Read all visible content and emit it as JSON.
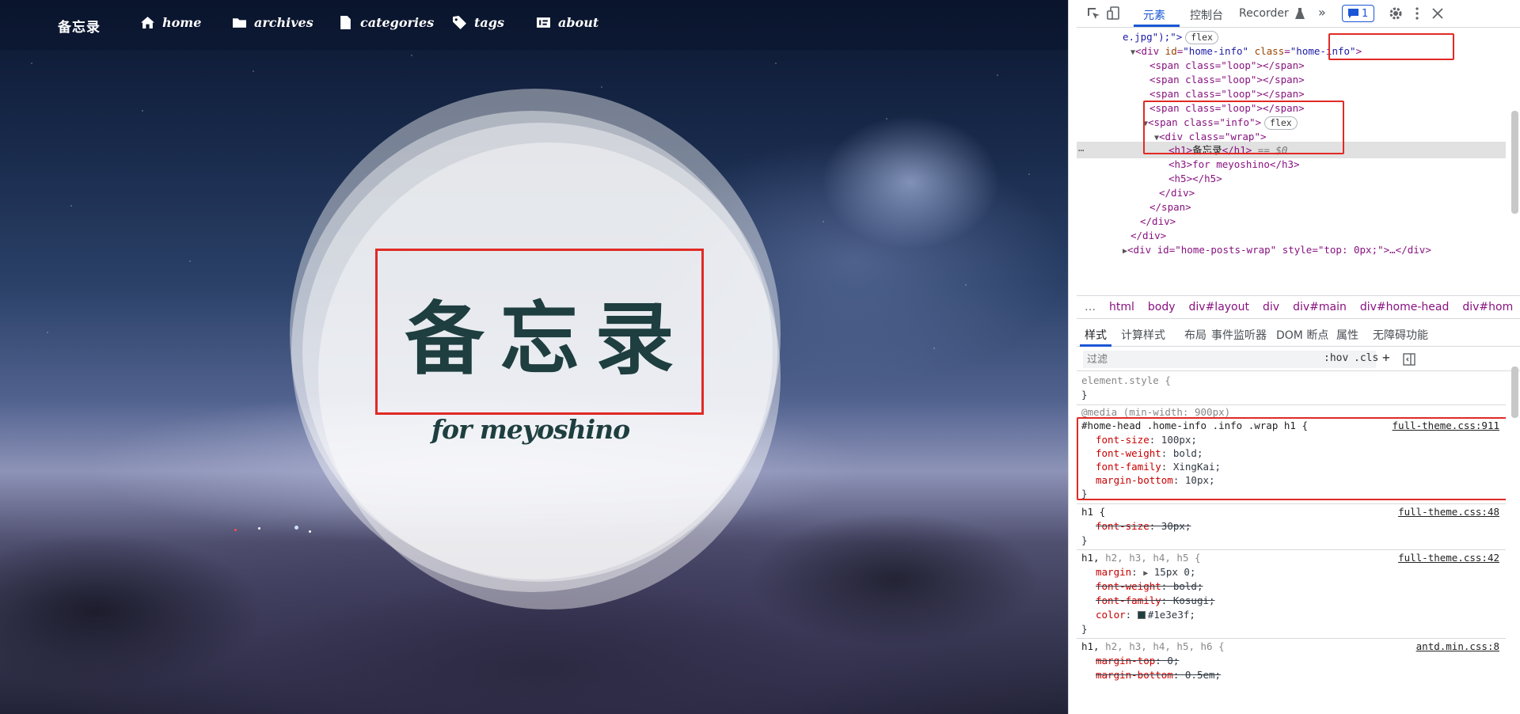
{
  "blog": {
    "brand": "备忘录",
    "nav": [
      {
        "label": "home",
        "icon": "home-icon"
      },
      {
        "label": "archives",
        "icon": "folder-icon"
      },
      {
        "label": "categories",
        "icon": "file-icon"
      },
      {
        "label": "tags",
        "icon": "tag-icon"
      },
      {
        "label": "about",
        "icon": "about-card-icon"
      }
    ],
    "title": "备忘录",
    "subtitle": "for meyoshino"
  },
  "devtools": {
    "tabs": [
      "元素",
      "控制台",
      "Recorder"
    ],
    "more_tabs_glyph": "»",
    "issues_count": "1",
    "tree": {
      "l0": {
        "pre": "e.jpg\");\">",
        "pill": "flex"
      },
      "l1": {
        "tag_open": "<div",
        "id_attr": "id",
        "id_val": "\"home-info\"",
        "class_attr": "class",
        "class_val": "\"home-info\"",
        "close": ">"
      },
      "loop_lines": [
        "<span class=\"loop\"></span>",
        "<span class=\"loop\"></span>",
        "<span class=\"loop\"></span>",
        "<span class=\"loop\"></span>"
      ],
      "info_line": {
        "text": "<span class=\"info\">",
        "pill": "flex"
      },
      "wrap_line": "<div class=\"wrap\">",
      "h1_line": {
        "open": "<h1>",
        "text": "备忘录",
        "close": "</h1>",
        "dollar": "== $0"
      },
      "h3_line": "<h3>for meyoshino</h3>",
      "h5_line": "<h5></h5>",
      "close_div_1": "</div>",
      "close_span": "</span>",
      "close_div_2": "</div>",
      "close_div_3": "</div>",
      "last_line": "<div id=\"home-posts-wrap\" style=\"top: 0px;\">…</div>"
    },
    "breadcrumbs": [
      "…",
      "html",
      "body",
      "div#layout",
      "div",
      "div#main",
      "div#home-head",
      "div#hom",
      "…"
    ],
    "subtabs": [
      "样式",
      "计算样式",
      "布局",
      "事件监听器",
      "DOM 断点",
      "属性",
      "无障碍功能"
    ],
    "filter_placeholder": "过滤",
    "filter_buttons": [
      ":hov",
      ".cls",
      "+"
    ],
    "rules": {
      "element_style": "element.style {",
      "brace_close": "}",
      "media": "@media (min-width: 900px)",
      "r1": {
        "selector": "#home-head .home-info .info .wrap h1 {",
        "source": "full-theme.css:911",
        "props": [
          {
            "name": "font-size",
            "value": "100px;"
          },
          {
            "name": "font-weight",
            "value": "bold;"
          },
          {
            "name": "font-family",
            "value": "XingKai;"
          },
          {
            "name": "margin-bottom",
            "value": "10px;"
          }
        ]
      },
      "r2": {
        "selector": "h1 {",
        "source": "full-theme.css:48",
        "prop": "font-size",
        "value": "30px;"
      },
      "r3": {
        "selector": "h1,",
        "selector_dim": "h2, h3, h4, h5 {",
        "source": "full-theme.css:42",
        "margin": {
          "name": "margin",
          "value": "15px 0;"
        },
        "fw": {
          "name": "font-weight",
          "value": "bold;"
        },
        "ff": {
          "name": "font-family",
          "value": "Kosugi;"
        },
        "color": {
          "name": "color",
          "value": "#1e3e3f;"
        }
      },
      "r4": {
        "selector": "h1,",
        "selector_dim": "h2, h3, h4, h5, h6 {",
        "source": "antd.min.css:8",
        "mt": {
          "name": "margin-top",
          "value": "0;"
        },
        "mb": {
          "name": "margin-bottom",
          "value": "0.5em;"
        }
      }
    }
  },
  "colors": {
    "title": "#1e3e3f",
    "highlight_box": "#e02a25",
    "devtools_accent": "#1a56d6"
  }
}
